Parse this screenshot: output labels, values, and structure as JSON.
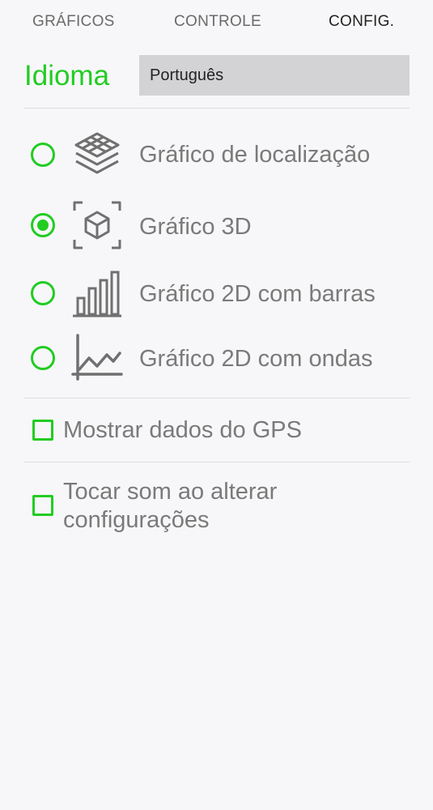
{
  "tabs": [
    {
      "label": "GRÁFICOS"
    },
    {
      "label": "CONTROLE"
    },
    {
      "label": "CONFIG."
    }
  ],
  "language": {
    "label": "Idioma",
    "selected": "Português"
  },
  "graph_options": [
    {
      "label": "Gráfico de localização",
      "icon": "layers-icon",
      "selected": false
    },
    {
      "label": "Gráfico 3D",
      "icon": "cube-3d-icon",
      "selected": true
    },
    {
      "label": "Gráfico 2D com barras",
      "icon": "bar-chart-icon",
      "selected": false
    },
    {
      "label": "Gráfico 2D com ondas",
      "icon": "line-chart-icon",
      "selected": false
    }
  ],
  "checkboxes": {
    "gps": {
      "label": "Mostrar dados do GPS",
      "checked": false
    },
    "sound": {
      "line1": "Tocar som ao alterar",
      "line2": "configurações",
      "checked": false
    }
  },
  "colors": {
    "accent": "#22cc22",
    "text_muted": "#7a7a7a",
    "select_bg": "#d3d3d6"
  }
}
